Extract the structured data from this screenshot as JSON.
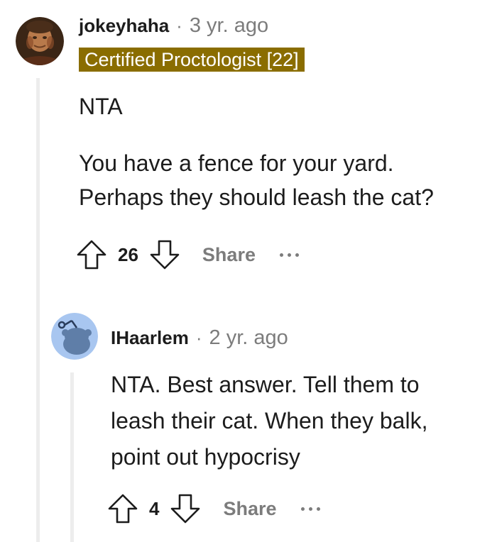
{
  "comments": [
    {
      "username": "jokeyhaha",
      "separator": "·",
      "time": "3 yr. ago",
      "flair": "Certified Proctologist [22]",
      "paragraphs": [
        "NTA",
        "You have a fence for your yard. Perhaps they should leash the cat?"
      ],
      "votes": "26",
      "share_label": "Share",
      "avatar_icon": "painting-portrait-avatar",
      "more_icon": "more-options-icon"
    },
    {
      "username": "IHaarlem",
      "separator": "·",
      "time": "2 yr. ago",
      "paragraphs": [
        "NTA. Best answer. Tell them to leash their cat. When they balk, point out hypocrisy"
      ],
      "votes": "4",
      "share_label": "Share",
      "avatar_icon": "snoo-default-avatar",
      "more_icon": "more-options-icon"
    }
  ],
  "colors": {
    "flair_bg": "#8a6d00",
    "meta_gray": "#7c7c7c",
    "thread_line": "#ededed",
    "snoo_avatar_bg": "#a8c6f0"
  }
}
